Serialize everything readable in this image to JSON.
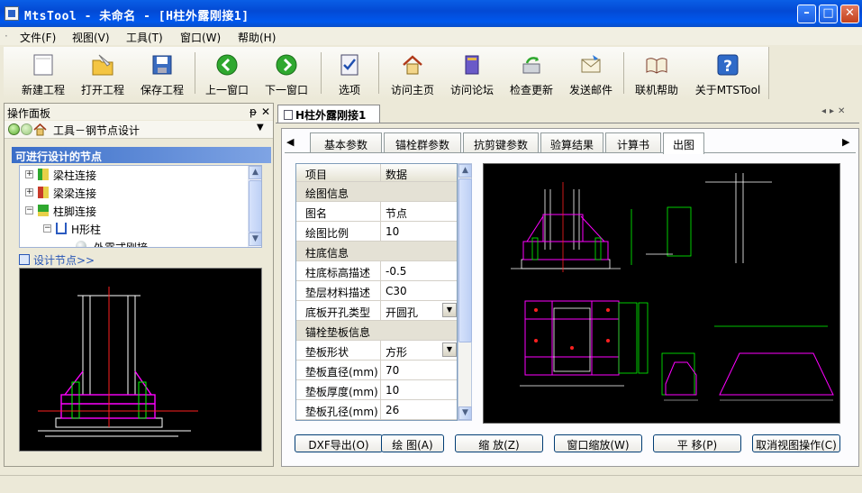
{
  "window": {
    "title": "MtsTool - 未命名 - [H柱外露刚接1]"
  },
  "menu": [
    "文件(F)",
    "视图(V)",
    "工具(T)",
    "窗口(W)",
    "帮助(H)"
  ],
  "toolbar": {
    "new": "新建工程",
    "open": "打开工程",
    "save": "保存工程",
    "prev": "上一窗口",
    "next": "下一窗口",
    "options": "选项",
    "home": "访问主页",
    "forum": "访问论坛",
    "update": "检查更新",
    "mail": "发送邮件",
    "help": "联机帮助",
    "about": "关于MTSTool"
  },
  "panel": {
    "title": "操作面板",
    "pin": "ᵽ",
    "close": "✕",
    "path": "工具－钢节点设计",
    "section": "可进行设计的节点",
    "tree": [
      {
        "box": "+",
        "label": "梁柱连接"
      },
      {
        "box": "+",
        "label": "梁梁连接"
      },
      {
        "box": "−",
        "label": "柱脚连接"
      },
      {
        "box": "−",
        "label": "H形柱"
      },
      {
        "box": "",
        "label": "外露式刚接"
      }
    ],
    "design_link": "设计节点>>"
  },
  "doc": {
    "tab": "H柱外露刚接1"
  },
  "tabs": [
    "基本参数",
    "锚栓群参数",
    "抗剪键参数",
    "验算结果",
    "计算书",
    "出图"
  ],
  "active_tab": "出图",
  "grid": {
    "header": [
      "项目",
      "数据"
    ],
    "rows": [
      {
        "type": "cat",
        "label": "绘图信息"
      },
      {
        "type": "row",
        "label": "图名",
        "value": "节点"
      },
      {
        "type": "row",
        "label": "绘图比例",
        "value": "10"
      },
      {
        "type": "cat",
        "label": "柱底信息"
      },
      {
        "type": "row",
        "label": "柱底标高描述",
        "value": "-0.5"
      },
      {
        "type": "row",
        "label": "垫层材料描述",
        "value": "C30"
      },
      {
        "type": "row",
        "label": "底板开孔类型",
        "value": "开圆孔",
        "dropdown": true
      },
      {
        "type": "cat",
        "label": "锚栓垫板信息"
      },
      {
        "type": "row",
        "label": "垫板形状",
        "value": "方形",
        "dropdown": true
      },
      {
        "type": "row",
        "label": "垫板直径(mm)",
        "value": "70"
      },
      {
        "type": "row",
        "label": "垫板厚度(mm)",
        "value": "10"
      },
      {
        "type": "row",
        "label": "垫板孔径(mm)",
        "value": "26"
      }
    ]
  },
  "buttons": [
    "DXF导出(O)",
    "绘 图(A)",
    "缩 放(Z)",
    "窗口缩放(W)",
    "平 移(P)",
    "取消视图操作(C)"
  ],
  "colors": {
    "titlebar": "#0A5FE6",
    "drawing_bg": "#000000",
    "cad_magenta": "#FF00FF",
    "cad_green": "#00FF00",
    "cad_red": "#FF2020",
    "cad_white": "#FFFFFF"
  }
}
